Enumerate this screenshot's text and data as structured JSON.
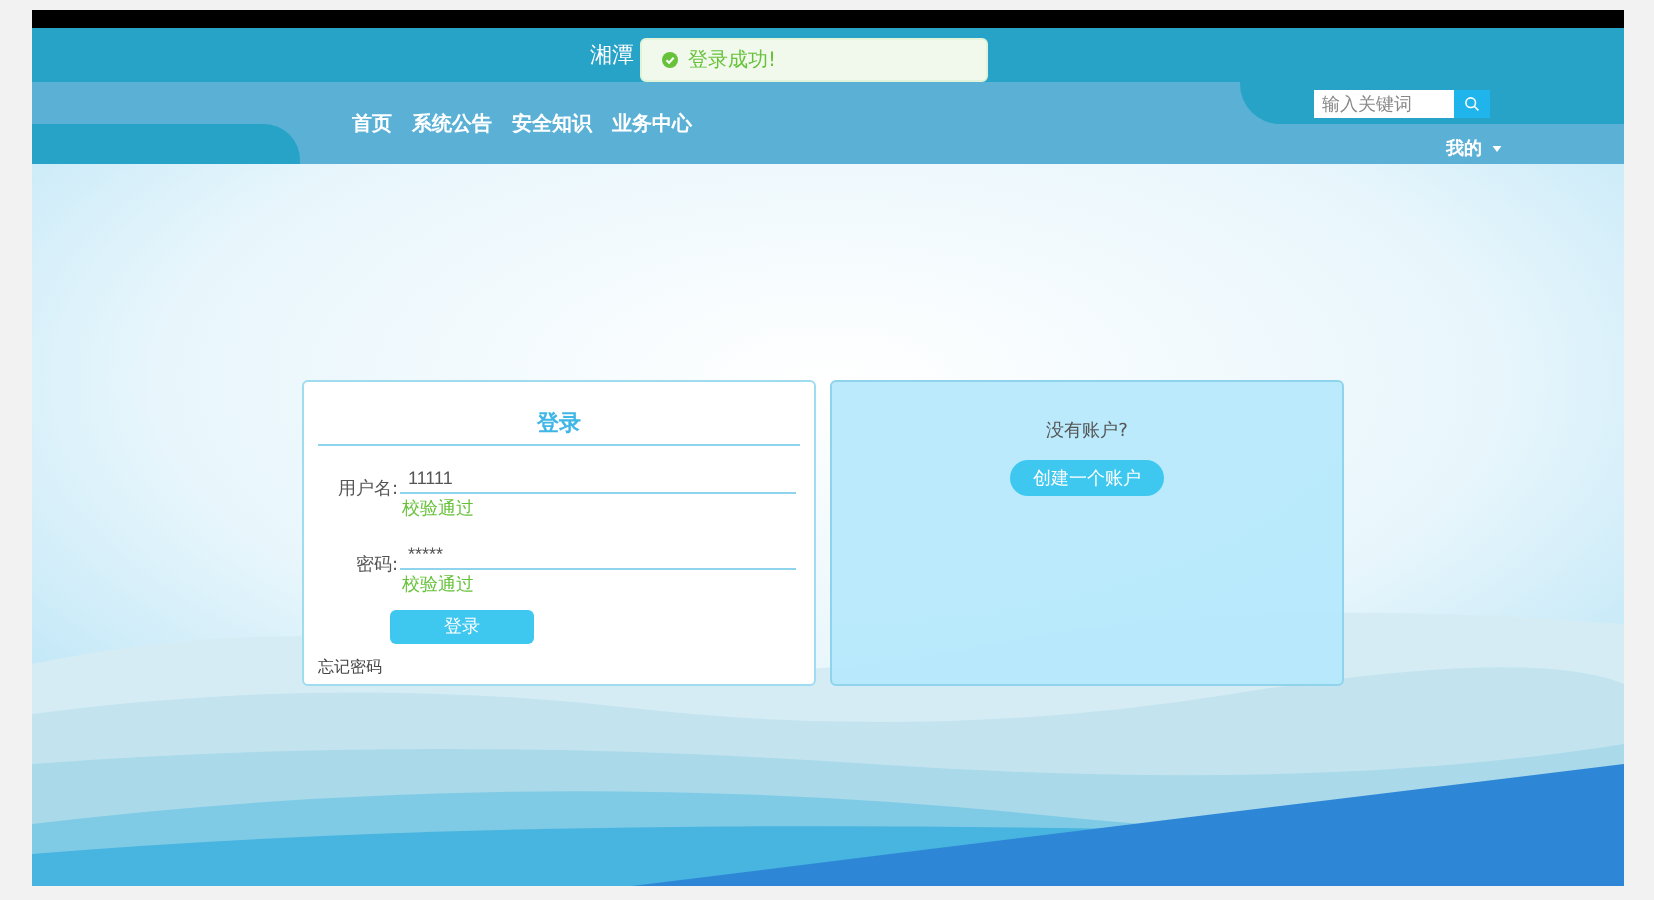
{
  "header": {
    "title": "湘潭"
  },
  "toast": {
    "kind": "success",
    "message": "登录成功!"
  },
  "nav": {
    "items": [
      {
        "label": "首页"
      },
      {
        "label": "系统公告"
      },
      {
        "label": "安全知识"
      },
      {
        "label": "业务中心"
      }
    ]
  },
  "search": {
    "placeholder": "输入关键词"
  },
  "user_menu": {
    "label": "我的"
  },
  "login": {
    "title": "登录",
    "fields": [
      {
        "label": "用户名:",
        "value": "11111",
        "status": "校验通过"
      },
      {
        "label": "密码:",
        "value": "*****",
        "status": "校验通过"
      }
    ],
    "submit": "登录",
    "forgot": "忘记密码"
  },
  "register": {
    "prompt": "没有账户?",
    "button": "创建一个账户"
  }
}
